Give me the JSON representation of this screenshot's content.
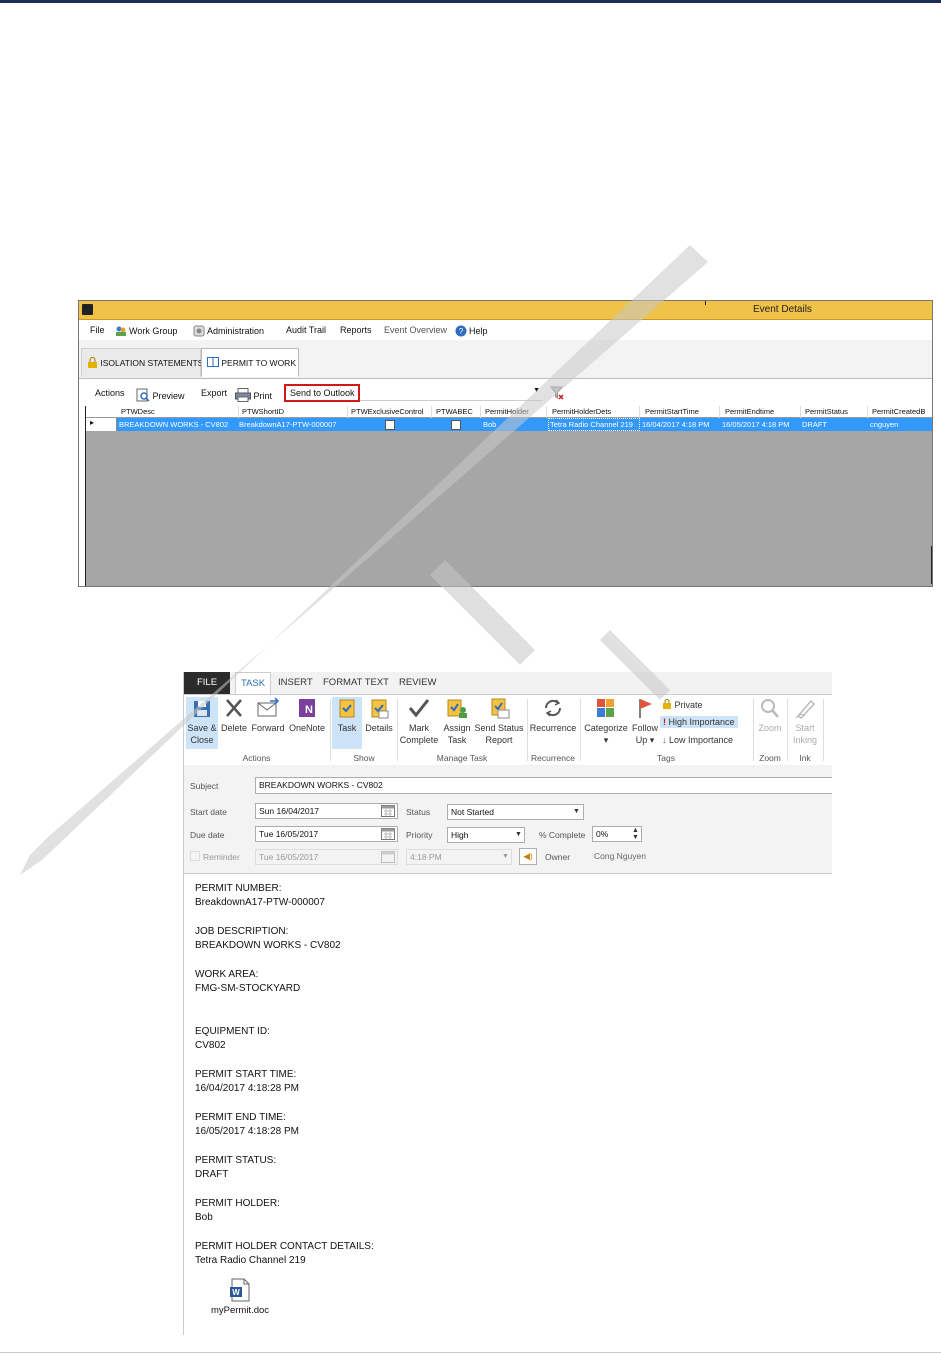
{
  "event_window": {
    "title": "Event Details",
    "menu": [
      "File",
      "Work Group",
      "Administration",
      "Audit Trail",
      "Reports",
      "Event Overview",
      "Help"
    ],
    "tabs": [
      "ISOLATION STATEMENTS",
      "PERMIT TO WORK"
    ],
    "toolbar": {
      "actions": "Actions",
      "preview": "Preview",
      "export": "Export",
      "print": "Print",
      "send_to_outlook": "Send to Outlook"
    },
    "columns": [
      "PTWDesc",
      "PTWShortID",
      "PTWExclusiveControl",
      "PTWABEC",
      "PermitHolder",
      "PermitHolderDets",
      "PermitStartTime",
      "PermitEndtime",
      "PermitStatus",
      "PermitCreatedB"
    ],
    "row": {
      "desc": "BREAKDOWN WORKS - CV802",
      "short_id": "BreakdownA17-PTW-000007",
      "exclusive_control": false,
      "abec": false,
      "holder": "Bob",
      "holder_dets": "Tetra Radio Channel 219",
      "start": "16/04/2017 4:18 PM",
      "end": "16/05/2017 4:18 PM",
      "status": "DRAFT",
      "created_by": "cnguyen"
    },
    "colors": {
      "title_bar": "#f0c248",
      "selected_row": "#3399ff",
      "highlight_border": "#d01a1a"
    }
  },
  "task_window": {
    "tabs": [
      "FILE",
      "TASK",
      "INSERT",
      "FORMAT TEXT",
      "REVIEW"
    ],
    "ribbon": {
      "save_close_1": "Save &",
      "save_close_2": "Close",
      "delete": "Delete",
      "forward": "Forward",
      "onenote": "OneNote",
      "group_actions": "Actions",
      "task": "Task",
      "details": "Details",
      "group_show": "Show",
      "mark_1": "Mark",
      "mark_2": "Complete",
      "assign_1": "Assign",
      "assign_2": "Task",
      "send_1": "Send Status",
      "send_2": "Report",
      "group_manage": "Manage Task",
      "recurrence": "Recurrence",
      "group_recurrence": "Recurrence",
      "categorize": "Categorize",
      "follow_1": "Follow",
      "follow_2": "Up",
      "private": "Private",
      "high": "High Importance",
      "low": "Low Importance",
      "group_tags": "Tags",
      "zoom": "Zoom",
      "group_zoom": "Zoom",
      "inking_1": "Start",
      "inking_2": "Inking",
      "group_ink": "Ink"
    },
    "form": {
      "subject_label": "Subject",
      "subject": "BREAKDOWN WORKS - CV802",
      "start_label": "Start date",
      "start": "Sun 16/04/2017",
      "status_label": "Status",
      "status": "Not Started",
      "due_label": "Due date",
      "due": "Tue 16/05/2017",
      "priority_label": "Priority",
      "priority": "High",
      "complete_label": "% Complete",
      "complete": "0%",
      "reminder_label": "Reminder",
      "reminder_date": "Tue 16/05/2017",
      "reminder_time": "4:18 PM",
      "owner_label": "Owner",
      "owner": "Cong Nguyen"
    },
    "body": [
      {
        "label": "PERMIT NUMBER:",
        "value": "BreakdownA17-PTW-000007"
      },
      {
        "label": "JOB DESCRIPTION:",
        "value": "BREAKDOWN WORKS - CV802"
      },
      {
        "label": "WORK AREA:",
        "value": "FMG-SM-STOCKYARD"
      },
      {
        "label": "EQUIPMENT ID:",
        "value": "CV802"
      },
      {
        "label": "PERMIT START TIME:",
        "value": "16/04/2017 4:18:28 PM"
      },
      {
        "label": "PERMIT END TIME:",
        "value": "16/05/2017 4:18:28 PM"
      },
      {
        "label": "PERMIT STATUS:",
        "value": "DRAFT"
      },
      {
        "label": "PERMIT HOLDER:",
        "value": "Bob"
      },
      {
        "label": "PERMIT HOLDER CONTACT DETAILS:",
        "value": "Tetra Radio Channel 219"
      }
    ],
    "attachment": "myPermit.doc"
  },
  "icons": [
    "app-icon",
    "workgroup-icon",
    "administration-icon",
    "help-icon",
    "lock-icon",
    "book-icon",
    "preview-icon",
    "print-icon",
    "filter-clear-icon",
    "save-close-icon",
    "delete-icon",
    "forward-icon",
    "onenote-icon",
    "task-icon",
    "details-icon",
    "checkmark-icon",
    "assign-icon",
    "send-status-icon",
    "recurrence-icon",
    "categorize-icon",
    "flag-icon",
    "lock-private-icon",
    "exclamation-icon",
    "down-arrow-icon",
    "zoom-icon",
    "pen-icon",
    "calendar-icon",
    "speaker-icon",
    "word-doc-icon"
  ]
}
